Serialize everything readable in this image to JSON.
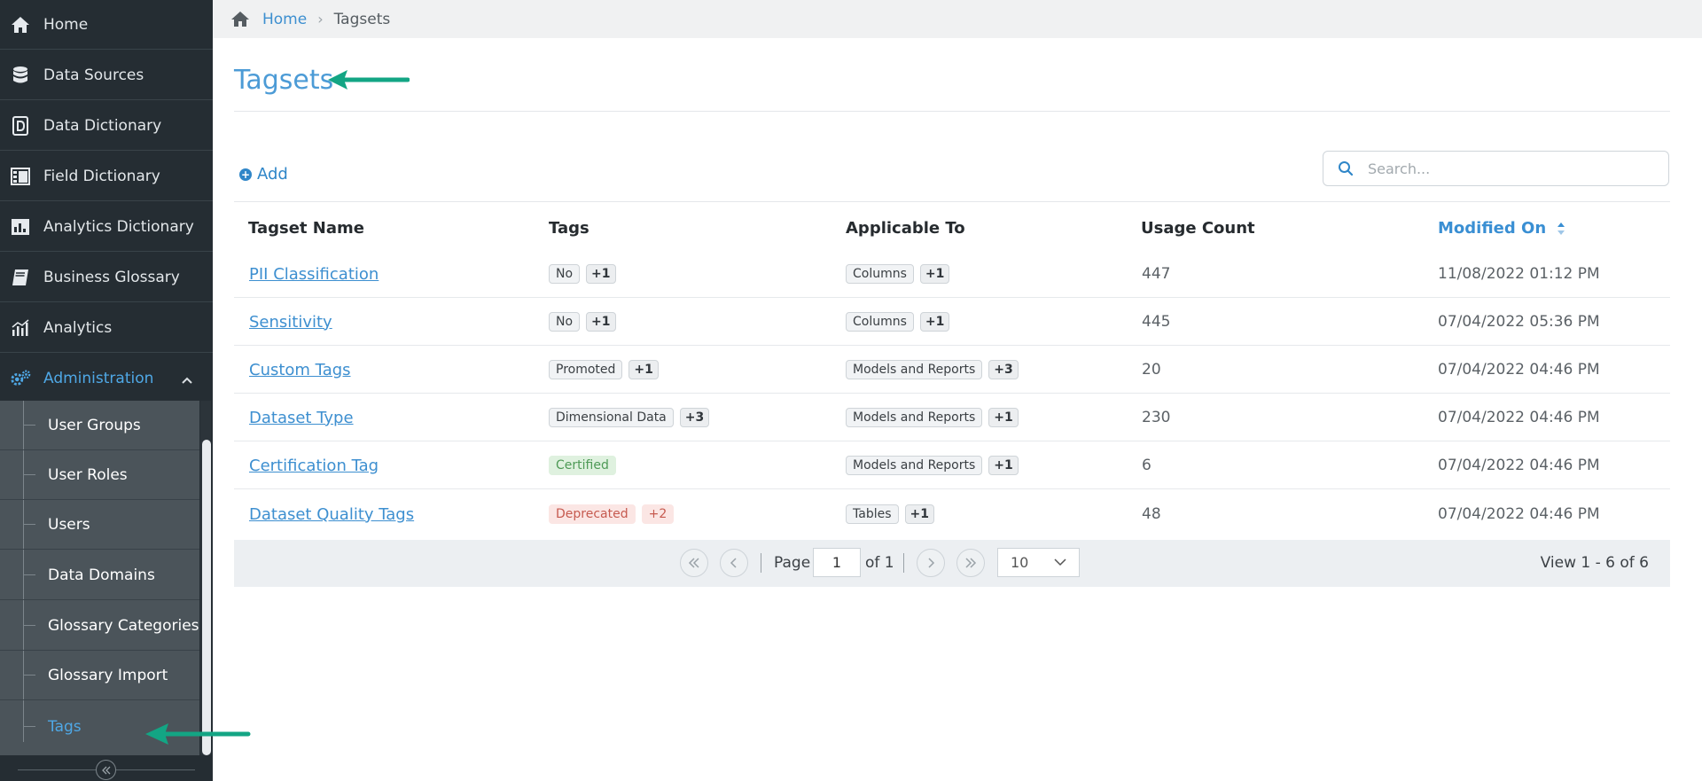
{
  "sidebar": {
    "items": [
      {
        "label": "Home",
        "icon": "home-icon"
      },
      {
        "label": "Data Sources",
        "icon": "database-icon"
      },
      {
        "label": "Data Dictionary",
        "icon": "dictionary-icon"
      },
      {
        "label": "Field Dictionary",
        "icon": "field-dictionary-icon"
      },
      {
        "label": "Analytics Dictionary",
        "icon": "bar-chart-icon"
      },
      {
        "label": "Business Glossary",
        "icon": "book-icon"
      },
      {
        "label": "Analytics",
        "icon": "analytics-icon"
      },
      {
        "label": "Administration",
        "icon": "gears-icon"
      }
    ],
    "admin_subitems": [
      {
        "label": "User Groups"
      },
      {
        "label": "User Roles"
      },
      {
        "label": "Users"
      },
      {
        "label": "Data Domains"
      },
      {
        "label": "Glossary Categories"
      },
      {
        "label": "Glossary Import"
      },
      {
        "label": "Tags"
      }
    ]
  },
  "breadcrumb": {
    "home": "Home",
    "current": "Tagsets"
  },
  "page": {
    "title": "Tagsets",
    "add_label": "Add",
    "search_placeholder": "Search..."
  },
  "table": {
    "columns": [
      "Tagset Name",
      "Tags",
      "Applicable To",
      "Usage Count",
      "Modified On"
    ],
    "sorted_column": "Modified On",
    "rows": [
      {
        "name": "PII Classification",
        "tag": "No",
        "tag_count": "+1",
        "tag_style": "default",
        "applies": "Columns",
        "applies_count": "+1",
        "usage": "447",
        "modified": "11/08/2022 01:12 PM"
      },
      {
        "name": "Sensitivity",
        "tag": "No",
        "tag_count": "+1",
        "tag_style": "default",
        "applies": "Columns",
        "applies_count": "+1",
        "usage": "445",
        "modified": "07/04/2022 05:36 PM"
      },
      {
        "name": "Custom Tags",
        "tag": "Promoted",
        "tag_count": "+1",
        "tag_style": "default",
        "applies": "Models and Reports",
        "applies_count": "+3",
        "usage": "20",
        "modified": "07/04/2022 04:46 PM"
      },
      {
        "name": "Dataset Type",
        "tag": "Dimensional Data",
        "tag_count": "+3",
        "tag_style": "default",
        "applies": "Models and Reports",
        "applies_count": "+1",
        "usage": "230",
        "modified": "07/04/2022 04:46 PM"
      },
      {
        "name": "Certification Tag",
        "tag": "Certified",
        "tag_count": "",
        "tag_style": "certified",
        "applies": "Models and Reports",
        "applies_count": "+1",
        "usage": "6",
        "modified": "07/04/2022 04:46 PM"
      },
      {
        "name": "Dataset Quality Tags",
        "tag": "Deprecated",
        "tag_count": "+2",
        "tag_style": "deprecated",
        "applies": "Tables",
        "applies_count": "+1",
        "usage": "48",
        "modified": "07/04/2022 04:46 PM"
      }
    ]
  },
  "pager": {
    "page_label": "Page",
    "page_value": "1",
    "of_label": "of 1",
    "page_size": "10",
    "view_label": "View 1 - 6 of 6"
  },
  "colors": {
    "sidebar_bg": "#252d33",
    "accent": "#3d8fd0",
    "annotation_arrow": "#13a584"
  }
}
